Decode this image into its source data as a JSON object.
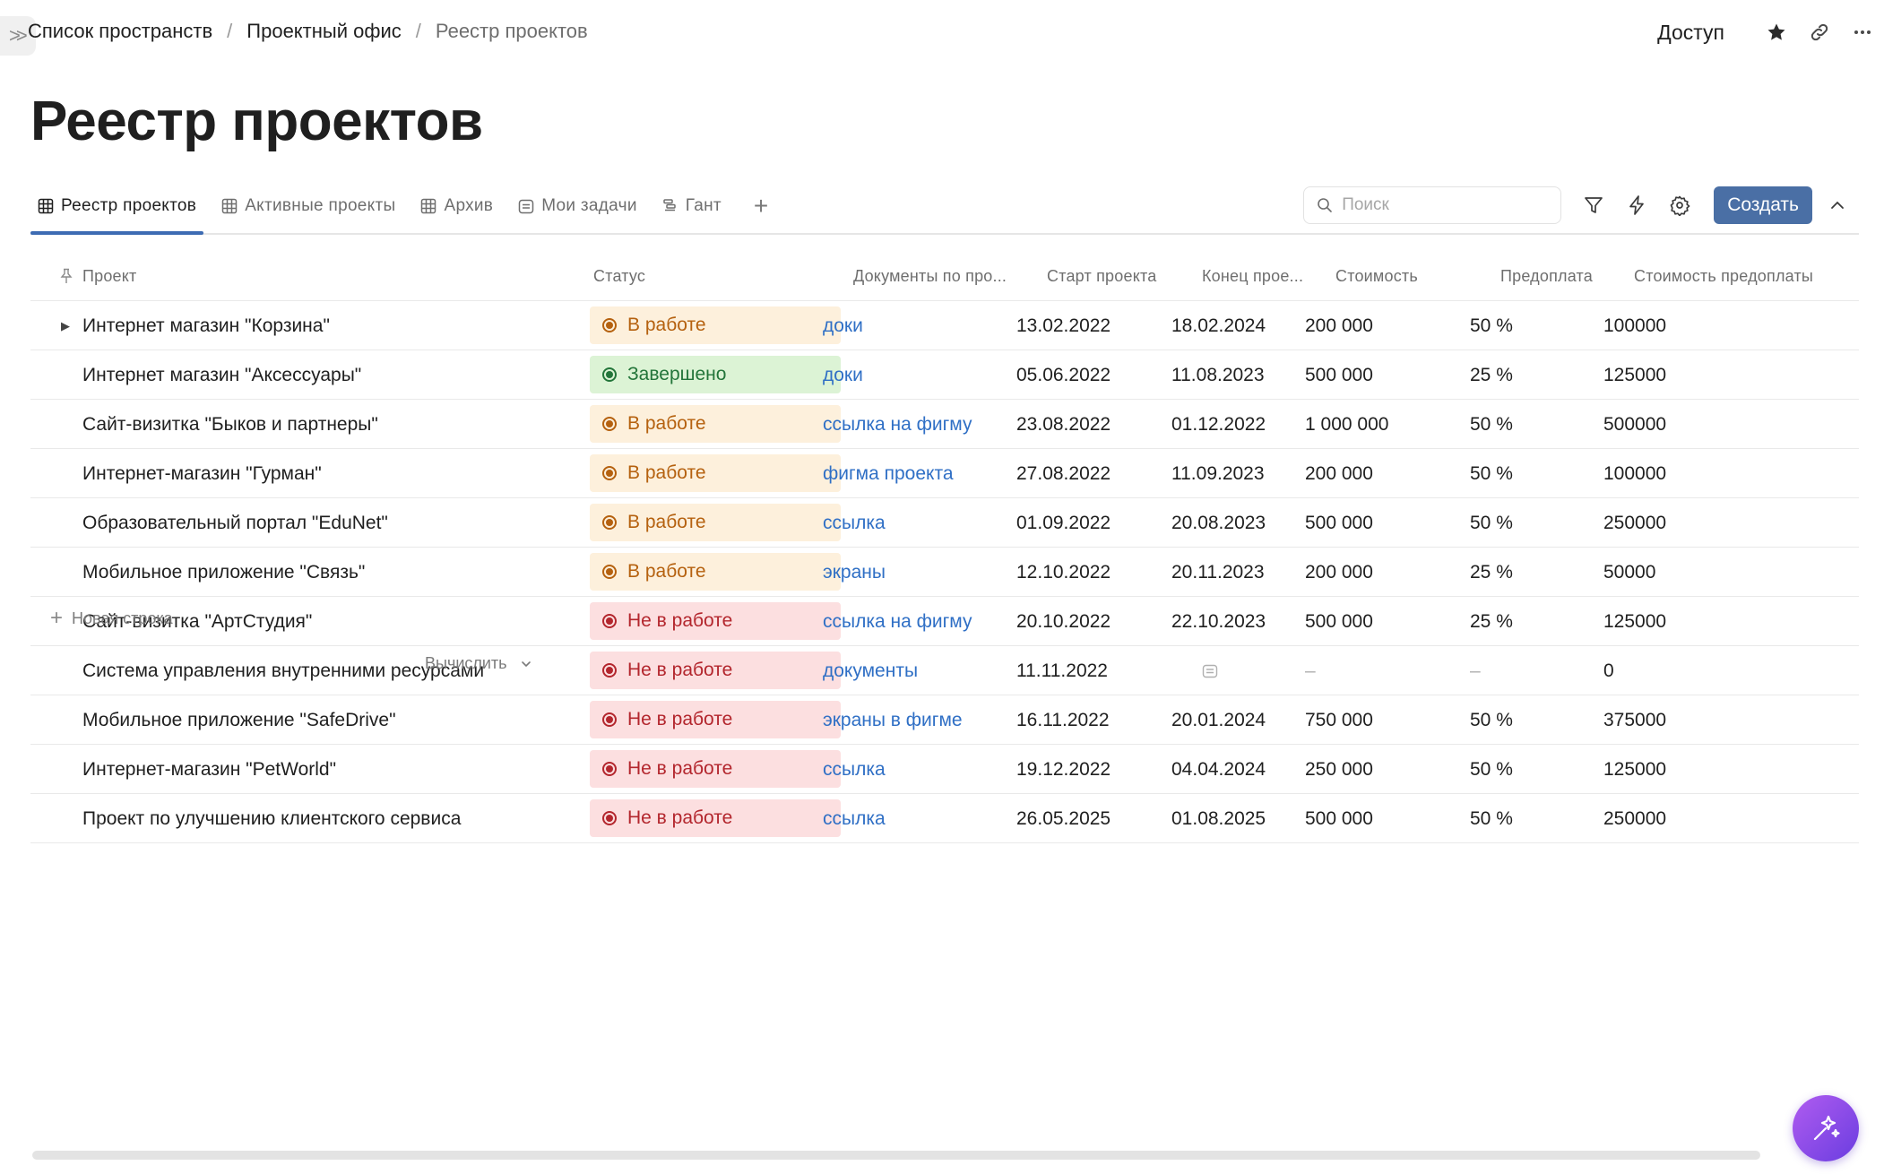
{
  "breadcrumb": {
    "items": [
      "Список пространств",
      "Проектный офис",
      "Реестр проектов"
    ],
    "separator": "/"
  },
  "header_actions": {
    "access_label": "Доступ",
    "icons": [
      "star-icon",
      "link-icon",
      "more-icon"
    ]
  },
  "page": {
    "title": "Реестр проектов"
  },
  "tabs": [
    {
      "label": "Реестр проектов",
      "icon": "table-icon",
      "active": true
    },
    {
      "label": "Активные проекты",
      "icon": "table-icon",
      "active": false
    },
    {
      "label": "Архив",
      "icon": "table-icon",
      "active": false
    },
    {
      "label": "Мои задачи",
      "icon": "calendar-icon",
      "active": false
    },
    {
      "label": "Гант",
      "icon": "gantt-icon",
      "active": false
    }
  ],
  "tab_add_label": "+",
  "toolbar": {
    "search_placeholder": "Поиск",
    "create_label": "Создать",
    "icons": [
      "filter-icon",
      "lightning-icon",
      "gear-icon",
      "chevron-up-icon"
    ]
  },
  "table": {
    "columns": [
      "Проект",
      "Статус",
      "Документы по про...",
      "Старт проекта",
      "Конец прое...",
      "Стоимость",
      "Предоплата",
      "Стоимость предоплаты"
    ],
    "rows": [
      {
        "project": "Интернет магазин \"Корзина\"",
        "status": "В работе",
        "status_kind": "in-progress",
        "doc": "доки",
        "start": "13.02.2022",
        "end": "18.02.2024",
        "cost": "200 000",
        "prepay": "50 %",
        "prepay_cost": "100000",
        "expandable": true
      },
      {
        "project": "Интернет магазин \"Аксессуары\"",
        "status": "Завершено",
        "status_kind": "done",
        "doc": "доки",
        "start": "05.06.2022",
        "end": "11.08.2023",
        "cost": "500 000",
        "prepay": "25 %",
        "prepay_cost": "125000"
      },
      {
        "project": "Сайт-визитка \"Быков и партнеры\"",
        "status": "В работе",
        "status_kind": "in-progress",
        "doc": "ссылка на фигму",
        "start": "23.08.2022",
        "end": "01.12.2022",
        "cost": "1 000 000",
        "prepay": "50 %",
        "prepay_cost": "500000"
      },
      {
        "project": "Интернет-магазин \"Гурман\"",
        "status": "В работе",
        "status_kind": "in-progress",
        "doc": "фигма проекта",
        "start": "27.08.2022",
        "end": "11.09.2023",
        "cost": "200 000",
        "prepay": "50 %",
        "prepay_cost": "100000"
      },
      {
        "project": "Образовательный портал \"EduNet\"",
        "status": "В работе",
        "status_kind": "in-progress",
        "doc": "ссылка",
        "start": "01.09.2022",
        "end": "20.08.2023",
        "cost": "500 000",
        "prepay": "50 %",
        "prepay_cost": "250000"
      },
      {
        "project": "Мобильное приложение \"Связь\"",
        "status": "В работе",
        "status_kind": "in-progress",
        "doc": "экраны",
        "start": "12.10.2022",
        "end": "20.11.2023",
        "cost": "200 000",
        "prepay": "25 %",
        "prepay_cost": "50000"
      },
      {
        "project": "Сайт-визитка \"АртСтудия\"",
        "status": "Не в работе",
        "status_kind": "not-started",
        "doc": "ссылка на фигму",
        "start": "20.10.2022",
        "end": "22.10.2023",
        "cost": "500 000",
        "prepay": "25 %",
        "prepay_cost": "125000"
      },
      {
        "project": "Система управления внутренними ресурсами",
        "status": "Не в работе",
        "status_kind": "not-started",
        "doc": "документы",
        "start": "11.11.2022",
        "end": "",
        "cost": "–",
        "prepay": "–",
        "prepay_cost": "0",
        "end_empty_icon": "calendar-icon"
      },
      {
        "project": "Мобильное приложение \"SafeDrive\"",
        "status": "Не в работе",
        "status_kind": "not-started",
        "doc": "экраны в фигме",
        "start": "16.11.2022",
        "end": "20.01.2024",
        "cost": "750 000",
        "prepay": "50 %",
        "prepay_cost": "375000"
      },
      {
        "project": "Интернет-магазин \"PetWorld\"",
        "status": "Не в работе",
        "status_kind": "not-started",
        "doc": "ссылка",
        "start": "19.12.2022",
        "end": "04.04.2024",
        "cost": "250 000",
        "prepay": "50 %",
        "prepay_cost": "125000"
      },
      {
        "project": "Проект по улучшению клиентского сервиса",
        "status": "Не в работе",
        "status_kind": "not-started",
        "doc": "ссылка",
        "start": "26.05.2025",
        "end": "01.08.2025",
        "cost": "500 000",
        "prepay": "50 %",
        "prepay_cost": "250000"
      }
    ],
    "new_row_label": "Новая строка",
    "calc_label": "Вычислить"
  },
  "status_colors": {
    "in-progress": {
      "bg": "#fdf0dc",
      "fg": "#b5610f"
    },
    "done": {
      "bg": "#dcf3d5",
      "fg": "#23753a"
    },
    "not-started": {
      "bg": "#fcdfe0",
      "fg": "#b3262d"
    }
  },
  "colors": {
    "accent": "#4a6fa5",
    "link": "#2f6fc5",
    "tab_underline": "#3d6bb3",
    "ai_button": "#8b4ce8"
  }
}
